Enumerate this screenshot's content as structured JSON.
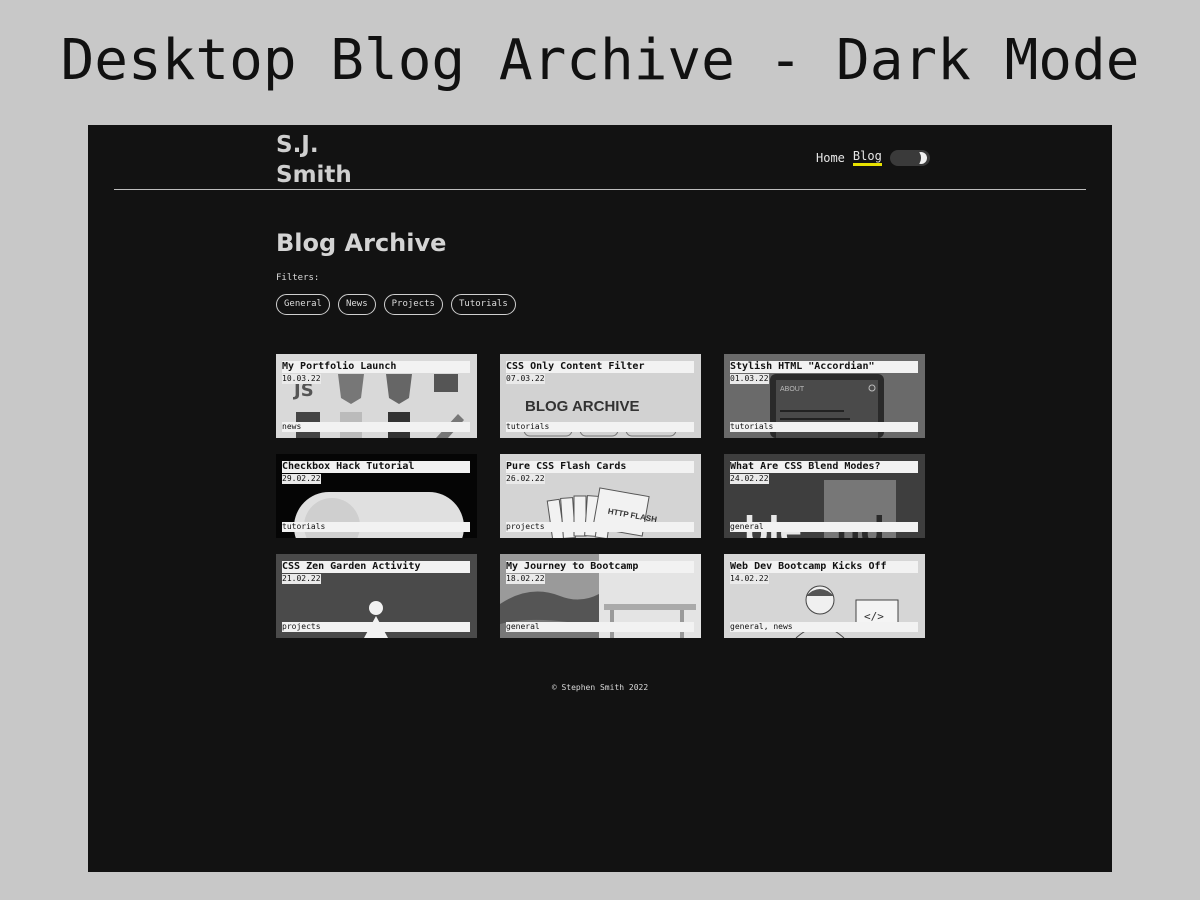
{
  "caption": "Desktop Blog Archive - Dark Mode",
  "header": {
    "brand_line1": "S.J.",
    "brand_line2": "Smith",
    "nav": [
      {
        "label": "Home",
        "active": false
      },
      {
        "label": "Blog",
        "active": true
      }
    ],
    "theme_toggle_icon": "moon-icon"
  },
  "main": {
    "title": "Blog Archive",
    "filters_label": "Filters:",
    "filters": [
      "General",
      "News",
      "Projects",
      "Tutorials"
    ]
  },
  "posts": [
    {
      "title": "My Portfolio Launch",
      "date": "10.03.22",
      "tags": "news",
      "thumb": "logo-icons-thumbnail"
    },
    {
      "title": "CSS Only Content Filter",
      "date": "07.03.22",
      "tags": "tutorials",
      "thumb": "blog-archive-screenshot-thumbnail",
      "thumb_text": "BLOG ARCHIVE"
    },
    {
      "title": "Stylish HTML \"Accordian\"",
      "date": "01.03.22",
      "tags": "tutorials",
      "thumb": "accordion-phone-thumbnail",
      "thumb_text": "ABOUT"
    },
    {
      "title": "Checkbox Hack Tutorial",
      "date": "29.02.22",
      "tags": "tutorials",
      "thumb": "toggle-switch-thumbnail"
    },
    {
      "title": "Pure CSS Flash Cards",
      "date": "26.02.22",
      "tags": "projects",
      "thumb": "flash-cards-thumbnail",
      "thumb_text": "HTTP FLASH"
    },
    {
      "title": "What Are CSS Blend Modes?",
      "date": "24.02.22",
      "tags": "general",
      "thumb": "blend-text-thumbnail"
    },
    {
      "title": "CSS Zen Garden Activity",
      "date": "21.02.22",
      "tags": "projects",
      "thumb": "zen-figure-thumbnail"
    },
    {
      "title": "My Journey to Bootcamp",
      "date": "18.02.22",
      "tags": "general",
      "thumb": "landscape-photo-thumbnail"
    },
    {
      "title": "Web Dev Bootcamp Kicks Off",
      "date": "14.02.22",
      "tags": "general, news",
      "thumb": "developer-illustration-thumbnail",
      "thumb_text": "</>"
    }
  ],
  "footer": {
    "text": "© Stephen Smith 2022"
  },
  "colors": {
    "page_bg": "#121212",
    "accent": "#e8e200",
    "text": "#d4d4d4"
  }
}
